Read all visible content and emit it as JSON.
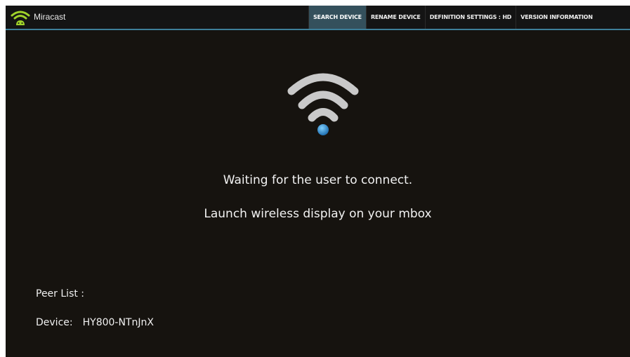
{
  "app": {
    "title": "Miracast",
    "icon": "wifi-robot-icon",
    "accent_color": "#3d7f99",
    "icon_color": "#9fd12a"
  },
  "tabs": [
    {
      "label": "SEARCH DEVICE",
      "active": true
    },
    {
      "label": "RENAME DEVICE",
      "active": false
    },
    {
      "label": "DEFINITION SETTINGS : HD",
      "active": false
    },
    {
      "label": "VERSION INFORMATION",
      "active": false
    }
  ],
  "status": {
    "icon": "wifi-signal-icon",
    "message": "Waiting for the user to connect.",
    "instruction": "Launch wireless display on your mbox"
  },
  "peers": {
    "label": "Peer List :",
    "device_label": "Device:",
    "device_name": "HY800-NTnJnX"
  }
}
